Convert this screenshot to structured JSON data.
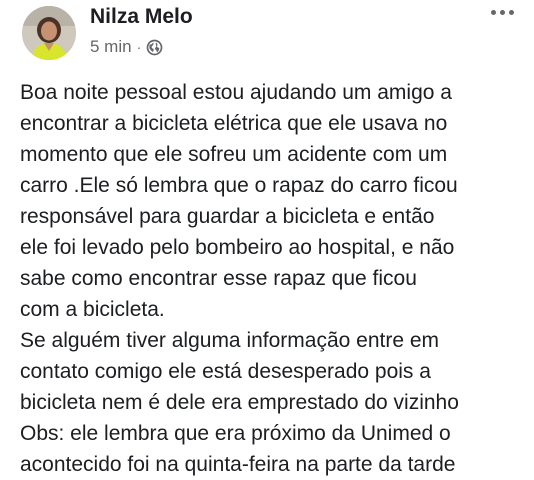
{
  "post": {
    "author": "Nilza Melo",
    "timestamp": "5 min",
    "separator": "·",
    "privacy_icon": "globe-icon",
    "menu_icon": "more-options-icon",
    "lines": [
      "Boa noite pessoal estou ajudando um amigo a",
      "encontrar a bicicleta elétrica que ele usava no",
      "momento que ele sofreu um acidente com um",
      "carro .Ele só lembra que o rapaz do carro ficou",
      "responsável para guardar a bicicleta e então",
      "ele foi levado pelo bombeiro ao hospital, e não",
      "sabe como encontrar esse rapaz que ficou",
      "com a bicicleta.",
      "Se alguém tiver alguma informação entre em",
      "contato comigo ele está desesperado pois a",
      "bicicleta nem é dele era emprestado do vizinho",
      "Obs: ele lembra que era próximo da Unimed o",
      "acontecido foi na quinta-feira na parte da tarde"
    ]
  },
  "colors": {
    "text": "#1c1e21",
    "secondary": "#65676b",
    "background": "#ffffff"
  }
}
